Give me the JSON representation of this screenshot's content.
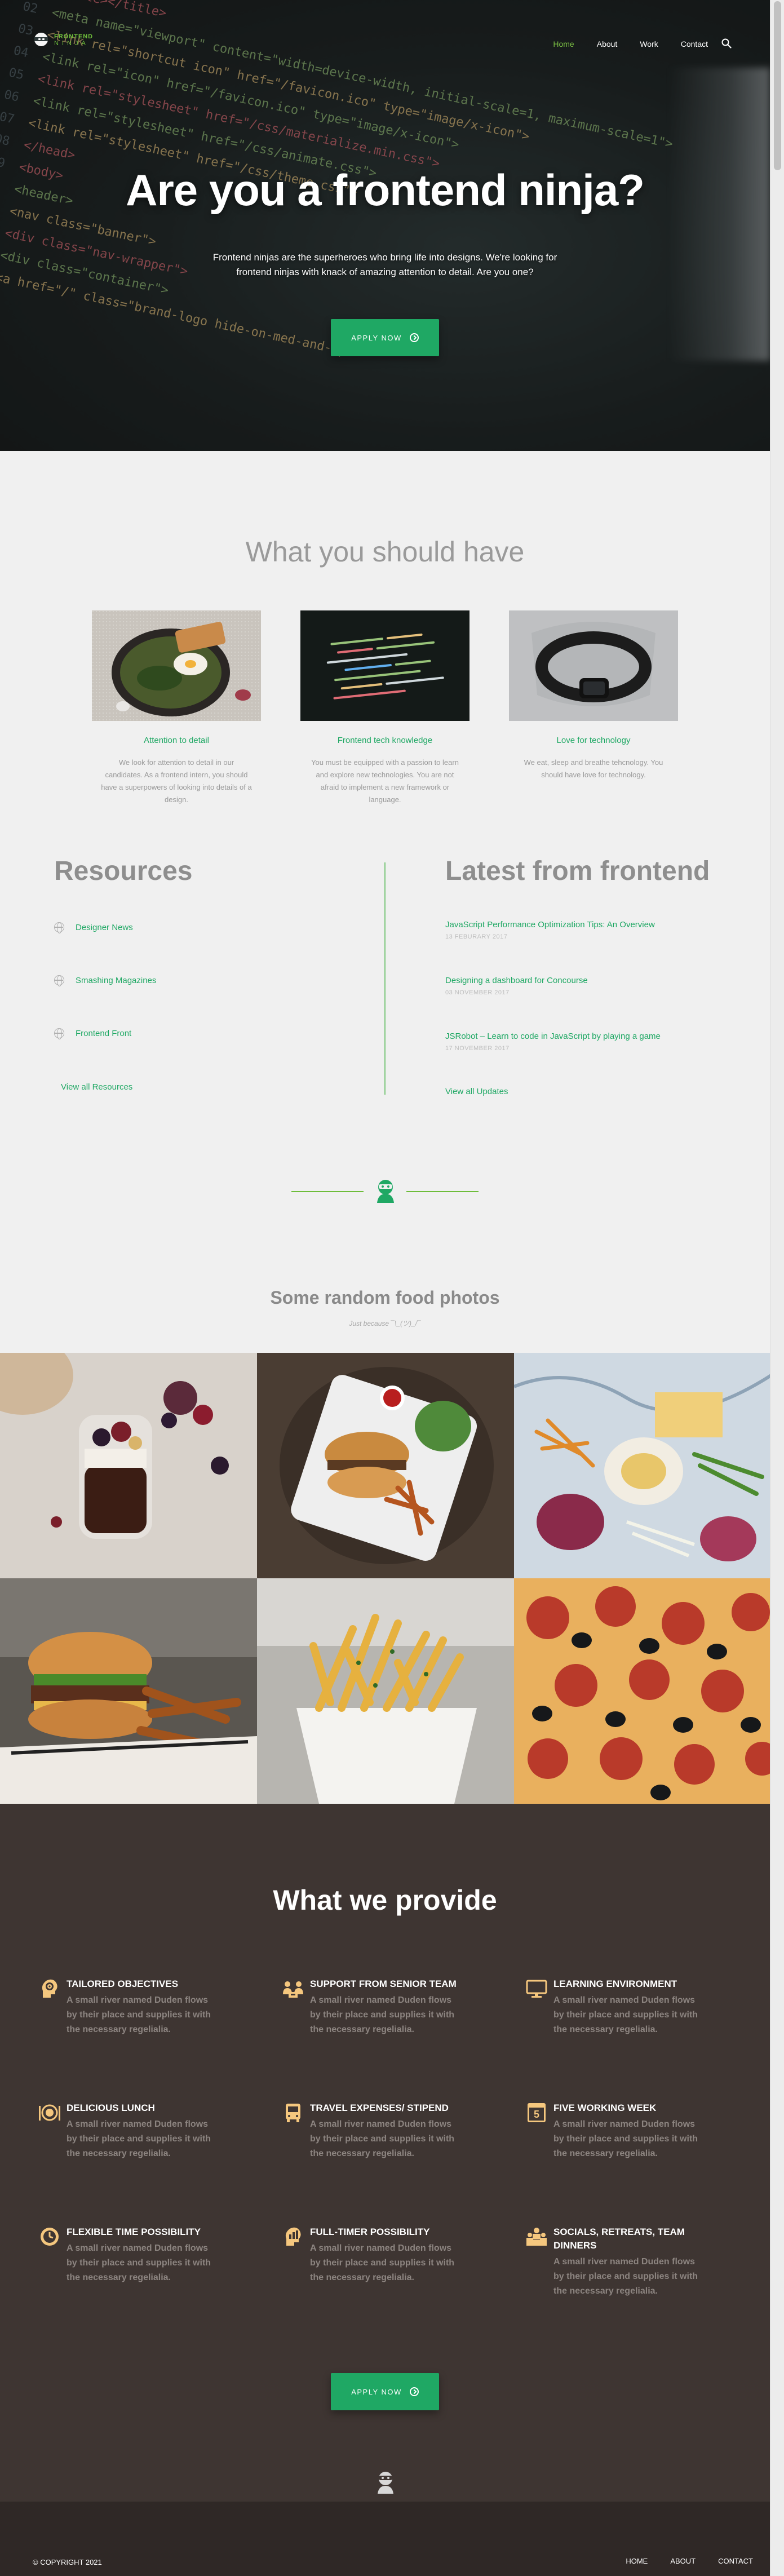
{
  "nav": {
    "logo_line1": "FRONTEND",
    "logo_line2": "NINJA",
    "links": [
      "Home",
      "About",
      "Work",
      "Contact"
    ],
    "active": "Home"
  },
  "hero": {
    "title": "Are you a frontend ninja?",
    "subtitle": "Frontend ninjas are the superheroes who bring life into designs. We're looking for frontend ninjas with knack of amazing attention to detail. Are you one?",
    "apply_label": "APPLY NOW",
    "code_lines": [
      "<title></title>",
      "<meta name=\"viewport\" content=\"width=device-width, initial-scale=1, maximum-scale=1\">",
      "<link rel=\"shortcut icon\" href=\"/favicon.ico\" type=\"image/x-icon\">",
      "<link rel=\"icon\" href=\"/favicon.ico\" type=\"image/x-icon\">",
      "<link rel=\"stylesheet\" href=\"/css/materialize.min.css\">",
      "<link rel=\"stylesheet\" href=\"/css/animate.css\">",
      "<link rel=\"stylesheet\" href=\"/css/theme.css\">",
      "</head>",
      "<body>",
      "<header>",
      "<nav class=\"banner\">",
      "<div class=\"nav-wrapper\">",
      "<div class=\"container\">",
      "<a href=\"/\" class=\"brand-logo hide-on-med-and-up\">"
    ]
  },
  "requirements": {
    "title": "What you should have",
    "cards": [
      {
        "title": "Attention to detail",
        "desc": "We look for attention to detail in our candidates. As a frontend intern, you should have a superpowers of looking into details of a design."
      },
      {
        "title": "Frontend tech knowledge",
        "desc": "You must be equipped with a passion to learn and explore new technologies. You are not afraid to implement a new framework or language."
      },
      {
        "title": "Love for technology",
        "desc": "We eat, sleep and breathe tehcnology. You should have love for technology."
      }
    ]
  },
  "resources": {
    "title": "Resources",
    "items": [
      "Designer News",
      "Smashing Magazines",
      "Frontend Front"
    ],
    "view_all": "View all Resources"
  },
  "latest": {
    "title": "Latest from frontend",
    "posts": [
      {
        "title": "JavaScript Performance Optimization Tips: An Overview",
        "date": "13 FEBURARY 2017"
      },
      {
        "title": "Designing a dashboard for Concourse",
        "date": "03 NOVEMBER 2017"
      },
      {
        "title": "JSRobot – Learn to code in JavaScript by playing a game",
        "date": "17 NOVEMBER 2017"
      }
    ],
    "view_all": "View all Updates"
  },
  "food": {
    "title": "Some random food photos",
    "subtitle": "Just because ¯\\_(ツ)_/¯"
  },
  "provide": {
    "title": "What we provide",
    "features": [
      {
        "title": "TAILORED OBJECTIVES",
        "desc": "A small river named Duden flows by their place and supplies it with the necessary regelialia.",
        "icon": "target-head-icon"
      },
      {
        "title": "SUPPORT FROM SENIOR TEAM",
        "desc": "A small river named Duden flows by their place and supplies it with the necessary regelialia.",
        "icon": "team-icon"
      },
      {
        "title": "LEARNING ENVIRONMENT",
        "desc": "A small river named Duden flows by their place and supplies it with the necessary regelialia.",
        "icon": "monitor-icon"
      },
      {
        "title": "DELICIOUS LUNCH",
        "desc": "A small river named Duden flows by their place and supplies it with the necessary regelialia.",
        "icon": "plate-icon"
      },
      {
        "title": "TRAVEL EXPENSES/ STIPEND",
        "desc": "A small river named Duden flows by their place and supplies it with the necessary regelialia.",
        "icon": "bus-icon"
      },
      {
        "title": "FIVE WORKING WEEK",
        "desc": "A small river named Duden flows by their place and supplies it with the necessary regelialia.",
        "icon": "calendar-icon"
      },
      {
        "title": "FLEXIBLE TIME POSSIBILITY",
        "desc": "A small river named Duden flows by their place and supplies it with the necessary regelialia.",
        "icon": "clock-icon"
      },
      {
        "title": "FULL-TIMER POSSIBILITY",
        "desc": "A small river named Duden flows by their place and supplies it with the necessary regelialia.",
        "icon": "growth-head-icon"
      },
      {
        "title": "SOCIALS, RETREATS, TEAM DINNERS",
        "desc": "A small river named Duden flows by their place and supplies it with the necessary regelialia.",
        "icon": "group-icon"
      }
    ],
    "apply_label": "APPLY NOW",
    "calendar_digit": "5"
  },
  "footer": {
    "copyright": "© COPYRIGHT 2021",
    "links": [
      "HOME",
      "ABOUT",
      "CONTACT"
    ]
  },
  "colors": {
    "accent": "#1fa864",
    "nav_active": "#7bc043",
    "provide_bg": "#3e3532",
    "icon": "#f5c77e"
  }
}
